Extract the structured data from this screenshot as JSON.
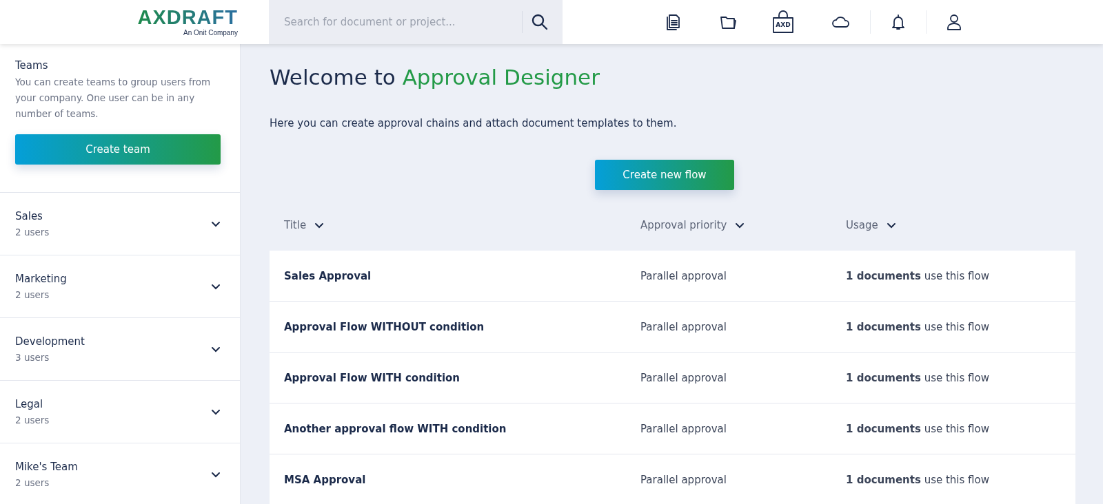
{
  "header": {
    "logo": "AXDRAFT",
    "logo_tagline": "An Onit Company",
    "bag_label": "AXD",
    "search": {
      "placeholder": "Search for document or project..."
    }
  },
  "sidebar": {
    "title": "Teams",
    "description": "You can create teams to group users from your company. One user can be in any number of teams.",
    "create_button": "Create team",
    "teams": [
      {
        "name": "Sales",
        "count": "2 users",
        "expanded": false
      },
      {
        "name": "Marketing",
        "count": "2 users",
        "expanded": false
      },
      {
        "name": "Development",
        "count": "3 users",
        "expanded": false
      },
      {
        "name": "Legal",
        "count": "2 users",
        "expanded": false
      },
      {
        "name": "Mike's Team",
        "count": "2 users",
        "expanded": false
      }
    ]
  },
  "main": {
    "title_prefix": "Welcome to",
    "title_highlight": "Approval Designer",
    "subtitle": "Here you can create approval chains and attach document templates to them.",
    "create_button": "Create new flow",
    "table": {
      "columns": [
        "Title",
        "Approval priority",
        "Usage"
      ],
      "rows": [
        {
          "title": "Sales Approval",
          "priority": "Parallel approval",
          "usage": "**1 documents** use this flow"
        },
        {
          "title": "Approval Flow WITHOUT condition",
          "priority": "Parallel approval",
          "usage": "**1 documents** use this flow"
        },
        {
          "title": "Approval Flow WITH condition",
          "priority": "Parallel approval",
          "usage": "**1 documents** use this flow"
        },
        {
          "title": "Another approval flow WITH condition",
          "priority": "Parallel approval",
          "usage": "**1 documents** use this flow"
        },
        {
          "title": "MSA Approval",
          "priority": "Parallel approval",
          "usage": "**1 documents** use this flow"
        }
      ]
    }
  }
}
